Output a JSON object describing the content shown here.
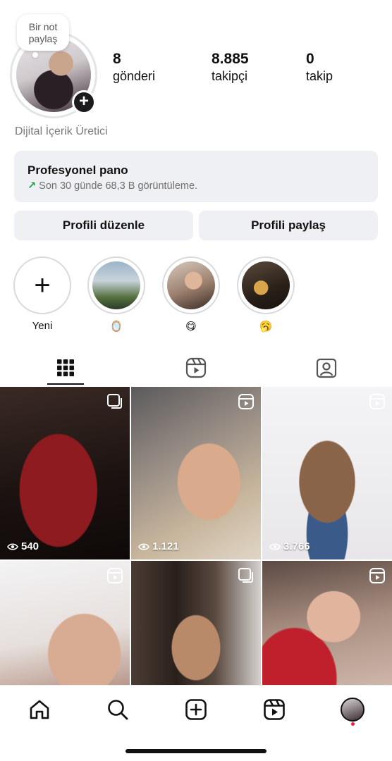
{
  "profile": {
    "note": "Bir not paylaş",
    "category": "Dijital İçerik Üretici",
    "stats": [
      {
        "value": "8",
        "label": "gönderi"
      },
      {
        "value": "8.885",
        "label": "takipçi"
      },
      {
        "value": "0",
        "label": "takip"
      }
    ]
  },
  "pro_panel": {
    "title": "Profesyonel pano",
    "subtitle": "Son 30 günde 68,3 B görüntüleme."
  },
  "buttons": {
    "edit": "Profili düzenle",
    "share": "Profili paylaş"
  },
  "highlights": [
    {
      "label": "Yeni"
    },
    {
      "label": "🪞"
    },
    {
      "label": "😋"
    },
    {
      "label": "🥱"
    }
  ],
  "grid": [
    {
      "views": "540",
      "type": "carousel"
    },
    {
      "views": "1.121",
      "type": "reel"
    },
    {
      "views": "3.766",
      "type": "reel"
    },
    {
      "views": "",
      "type": "reel"
    },
    {
      "views": "",
      "type": "carousel"
    },
    {
      "views": "",
      "type": "reel"
    }
  ],
  "colors": {
    "accent_dark": "#111111",
    "panel_bg": "#eff0f3",
    "trend_green": "#1e9e4a",
    "notification_red": "#ee1d3b"
  }
}
